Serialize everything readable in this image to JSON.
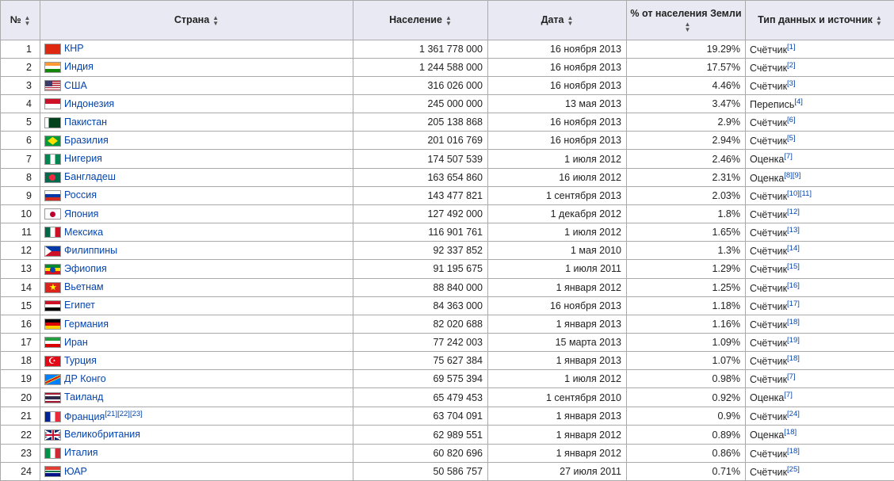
{
  "headers": {
    "num": "№",
    "country": "Страна",
    "population": "Население",
    "date": "Дата",
    "percent": "% от населения Земли",
    "type": "Тип данных и источник"
  },
  "rows": [
    {
      "n": "1",
      "flag": "cn",
      "country": "КНР",
      "refs_c": [],
      "pop": "1 361 778 000",
      "date": "16 ноября 2013",
      "pct": "19.29%",
      "type": "Счётчик",
      "refs_t": [
        "[1]"
      ]
    },
    {
      "n": "2",
      "flag": "in",
      "country": "Индия",
      "refs_c": [],
      "pop": "1 244 588 000",
      "date": "16 ноября 2013",
      "pct": "17.57%",
      "type": "Счётчик",
      "refs_t": [
        "[2]"
      ]
    },
    {
      "n": "3",
      "flag": "us",
      "country": "США",
      "refs_c": [],
      "pop": "316 026 000",
      "date": "16 ноября 2013",
      "pct": "4.46%",
      "type": "Счётчик",
      "refs_t": [
        "[3]"
      ]
    },
    {
      "n": "4",
      "flag": "id",
      "country": "Индонезия",
      "refs_c": [],
      "pop": "245 000 000",
      "date": "13 мая 2013",
      "pct": "3.47%",
      "type": "Перепись",
      "refs_t": [
        "[4]"
      ]
    },
    {
      "n": "5",
      "flag": "pk",
      "country": "Пакистан",
      "refs_c": [],
      "pop": "205 138 868",
      "date": "16 ноября 2013",
      "pct": "2.9%",
      "type": "Счётчик",
      "refs_t": [
        "[6]"
      ]
    },
    {
      "n": "6",
      "flag": "br",
      "country": "Бразилия",
      "refs_c": [],
      "pop": "201 016 769",
      "date": "16 ноября 2013",
      "pct": "2.94%",
      "type": "Счётчик",
      "refs_t": [
        "[5]"
      ]
    },
    {
      "n": "7",
      "flag": "ng",
      "country": "Нигерия",
      "refs_c": [],
      "pop": "174 507 539",
      "date": "1 июля 2012",
      "pct": "2.46%",
      "type": "Оценка",
      "refs_t": [
        "[7]"
      ]
    },
    {
      "n": "8",
      "flag": "bd",
      "country": "Бангладеш",
      "refs_c": [],
      "pop": "163 654 860",
      "date": "16 июля 2012",
      "pct": "2.31%",
      "type": "Оценка",
      "refs_t": [
        "[8]",
        "[9]"
      ]
    },
    {
      "n": "9",
      "flag": "ru",
      "country": "Россия",
      "refs_c": [],
      "pop": "143 477 821",
      "date": "1 сентября 2013",
      "pct": "2.03%",
      "type": "Счётчик",
      "refs_t": [
        "[10]",
        "[11]"
      ]
    },
    {
      "n": "10",
      "flag": "jp",
      "country": "Япония",
      "refs_c": [],
      "pop": "127 492 000",
      "date": "1 декабря 2012",
      "pct": "1.8%",
      "type": "Счётчик",
      "refs_t": [
        "[12]"
      ]
    },
    {
      "n": "11",
      "flag": "mx",
      "country": "Мексика",
      "refs_c": [],
      "pop": "116 901 761",
      "date": "1 июля 2012",
      "pct": "1.65%",
      "type": "Счётчик",
      "refs_t": [
        "[13]"
      ]
    },
    {
      "n": "12",
      "flag": "ph",
      "country": "Филиппины",
      "refs_c": [],
      "pop": "92 337 852",
      "date": "1 мая 2010",
      "pct": "1.3%",
      "type": "Счётчик",
      "refs_t": [
        "[14]"
      ]
    },
    {
      "n": "13",
      "flag": "et",
      "country": "Эфиопия",
      "refs_c": [],
      "pop": "91 195 675",
      "date": "1 июля 2011",
      "pct": "1.29%",
      "type": "Счётчик",
      "refs_t": [
        "[15]"
      ]
    },
    {
      "n": "14",
      "flag": "vn",
      "country": "Вьетнам",
      "refs_c": [],
      "pop": "88 840 000",
      "date": "1 января 2012",
      "pct": "1.25%",
      "type": "Счётчик",
      "refs_t": [
        "[16]"
      ]
    },
    {
      "n": "15",
      "flag": "eg",
      "country": "Египет",
      "refs_c": [],
      "pop": "84 363 000",
      "date": "16 ноября 2013",
      "pct": "1.18%",
      "type": "Счётчик",
      "refs_t": [
        "[17]"
      ]
    },
    {
      "n": "16",
      "flag": "de",
      "country": "Германия",
      "refs_c": [],
      "pop": "82 020 688",
      "date": "1 января 2013",
      "pct": "1.16%",
      "type": "Счётчик",
      "refs_t": [
        "[18]"
      ]
    },
    {
      "n": "17",
      "flag": "ir",
      "country": "Иран",
      "refs_c": [],
      "pop": "77 242 003",
      "date": "15 марта 2013",
      "pct": "1.09%",
      "type": "Счётчик",
      "refs_t": [
        "[19]"
      ]
    },
    {
      "n": "18",
      "flag": "tr",
      "country": "Турция",
      "refs_c": [],
      "pop": "75 627 384",
      "date": "1 января 2013",
      "pct": "1.07%",
      "type": "Счётчик",
      "refs_t": [
        "[18]"
      ]
    },
    {
      "n": "19",
      "flag": "cd",
      "country": "ДР Конго",
      "refs_c": [],
      "pop": "69 575 394",
      "date": "1 июля 2012",
      "pct": "0.98%",
      "type": "Счётчик",
      "refs_t": [
        "[7]"
      ]
    },
    {
      "n": "20",
      "flag": "th",
      "country": "Таиланд",
      "refs_c": [],
      "pop": "65 479 453",
      "date": "1 сентября 2010",
      "pct": "0.92%",
      "type": "Оценка",
      "refs_t": [
        "[7]"
      ]
    },
    {
      "n": "21",
      "flag": "fr",
      "country": "Франция",
      "refs_c": [
        "[21]",
        "[22]",
        "[23]"
      ],
      "pop": "63 704 091",
      "date": "1 января 2013",
      "pct": "0.9%",
      "type": "Счётчик",
      "refs_t": [
        "[24]"
      ]
    },
    {
      "n": "22",
      "flag": "gb",
      "country": "Великобритания",
      "refs_c": [],
      "pop": "62 989 551",
      "date": "1 января 2012",
      "pct": "0.89%",
      "type": "Оценка",
      "refs_t": [
        "[18]"
      ]
    },
    {
      "n": "23",
      "flag": "it",
      "country": "Италия",
      "refs_c": [],
      "pop": "60 820 696",
      "date": "1 января 2012",
      "pct": "0.86%",
      "type": "Счётчик",
      "refs_t": [
        "[18]"
      ]
    },
    {
      "n": "24",
      "flag": "za",
      "country": "ЮАР",
      "refs_c": [],
      "pop": "50 586 757",
      "date": "27 июля 2011",
      "pct": "0.71%",
      "type": "Счётчик",
      "refs_t": [
        "[25]"
      ]
    }
  ]
}
